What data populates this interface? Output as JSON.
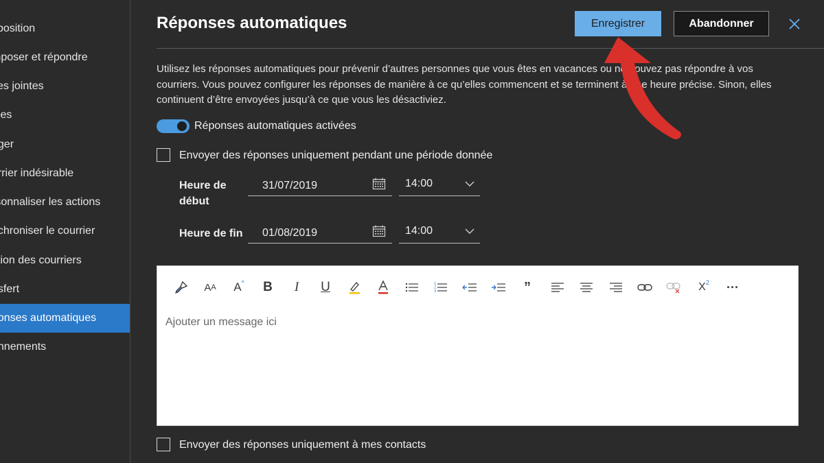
{
  "sidebar": {
    "items": [
      {
        "label": "sposition",
        "active": false
      },
      {
        "label": "mposer et répondre",
        "active": false
      },
      {
        "label": "ces jointes",
        "active": false
      },
      {
        "label": "gles",
        "active": false
      },
      {
        "label": "nger",
        "active": false
      },
      {
        "label": "urrier indésirable",
        "active": false
      },
      {
        "label": "rsonnaliser les actions",
        "active": false
      },
      {
        "label": "nchroniser le courrier",
        "active": false
      },
      {
        "label": "stion des courriers",
        "active": false
      },
      {
        "label": "nsfert",
        "active": false
      },
      {
        "label": "ponses automatiques",
        "active": true
      },
      {
        "label": "onnements",
        "active": false
      }
    ]
  },
  "header": {
    "title": "Réponses automatiques",
    "save_label": "Enregistrer",
    "cancel_label": "Abandonner",
    "close_icon": "close-icon"
  },
  "description": "Utilisez les réponses automatiques pour prévenir d’autres personnes que vous êtes en vacances ou ne pouvez pas répondre à vos courriers. Vous pouvez configurer les réponses de manière à ce qu’elles commencent et se terminent à une heure précise. Sinon, elles continuent d’être envoyées jusqu’à ce que vous les désactiviez.",
  "toggle": {
    "label": "Réponses automatiques activées",
    "on": true
  },
  "period_checkbox": {
    "label": "Envoyer des réponses uniquement pendant une période donnée",
    "checked": false
  },
  "start": {
    "label_line1": "Heure de",
    "label_line2": "début",
    "date": "31/07/2019",
    "time": "14:00"
  },
  "end": {
    "label": "Heure de fin",
    "date": "01/08/2019",
    "time": "14:00"
  },
  "editor": {
    "placeholder": "Ajouter un message ici",
    "toolbar": [
      "format-painter-icon",
      "font-size-icon",
      "grow-font-icon",
      "bold-icon",
      "italic-icon",
      "underline-icon",
      "highlight-icon",
      "font-color-icon",
      "bullets-icon",
      "numbering-icon",
      "decrease-indent-icon",
      "increase-indent-icon",
      "quote-icon",
      "align-left-icon",
      "align-center-icon",
      "align-right-icon",
      "insert-link-icon",
      "remove-link-icon",
      "superscript-icon",
      "more-options-icon"
    ]
  },
  "contacts_checkbox": {
    "label": "Envoyer des réponses uniquement à mes contacts",
    "checked": false
  },
  "colors": {
    "accent": "#2b79c9",
    "save_button": "#6aaee8",
    "background": "#2b2b2b",
    "annotation_arrow": "#d9302b"
  }
}
